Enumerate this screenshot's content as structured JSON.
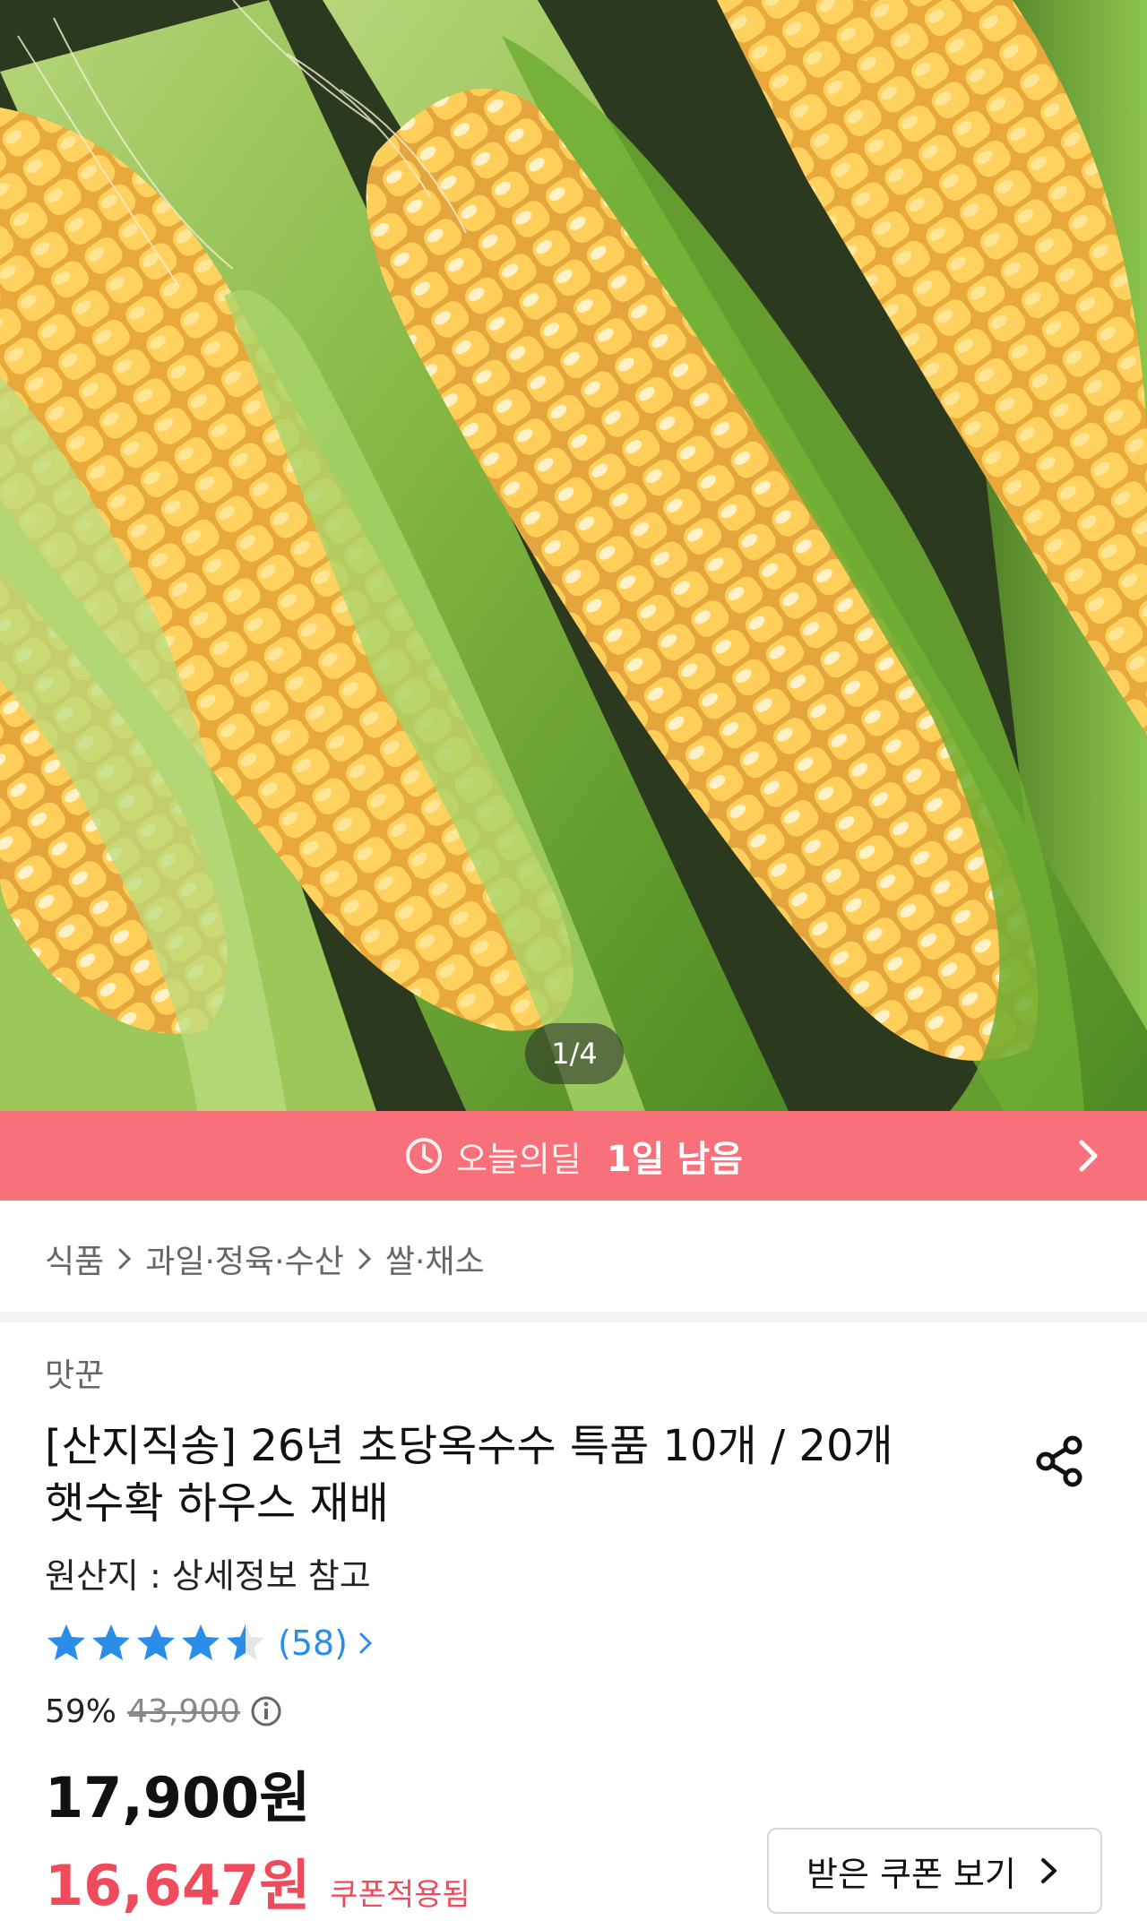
{
  "hero": {
    "image_description": "corn-cobs-product-photo",
    "page_counter": "1/4"
  },
  "deal_banner": {
    "icon": "clock-icon",
    "label": "오늘의딜",
    "remaining": "1일 남음",
    "color": "#f8717a"
  },
  "breadcrumb": [
    "식품",
    "과일·정육·수산",
    "쌀·채소"
  ],
  "product": {
    "seller": "맛꾼",
    "title_line1": "[산지직송] 26년 초당옥수수 특품 10개 / 20개",
    "title_line2": "햇수확 하우스 재배",
    "origin": "원산지 : 상세정보 참고",
    "rating": 4.5,
    "review_count": "(58)",
    "discount_percent": "59%",
    "original_price": "43,900",
    "price": "17,900원",
    "coupon_price": "16,647원",
    "coupon_tag": "쿠폰적용됨",
    "coupon_button": "받은 쿠폰 보기"
  },
  "colors": {
    "accent_red": "#ee4b5c",
    "star_blue": "#2a8de8",
    "link_blue": "#2a8de8"
  }
}
